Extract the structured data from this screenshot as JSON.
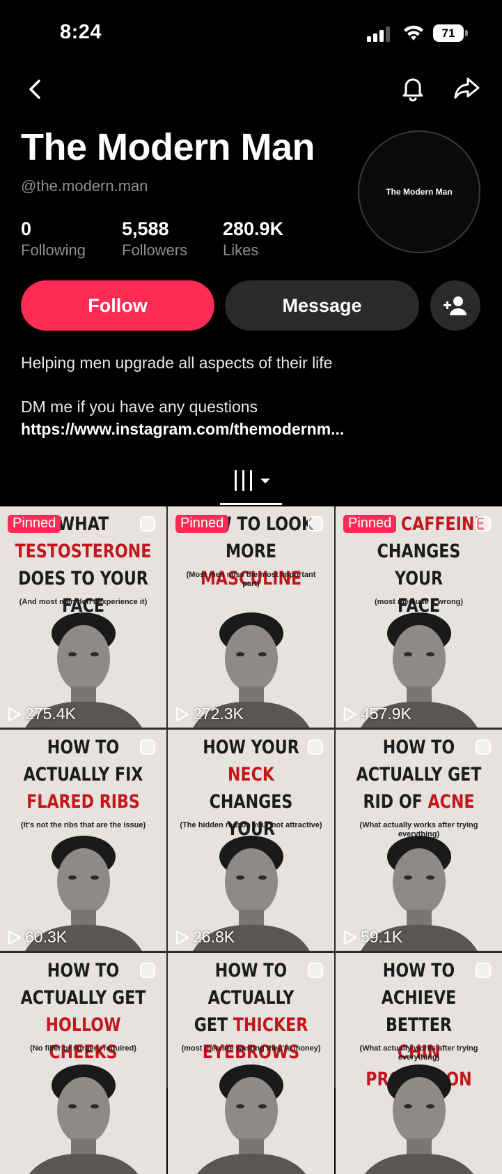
{
  "status_bar": {
    "time": "8:24",
    "battery": "71"
  },
  "profile": {
    "name": "The Modern Man",
    "handle": "@the.modern.man",
    "avatar_text": "The Modern Man",
    "stats": [
      {
        "value": "0",
        "label": "Following"
      },
      {
        "value": "5,588",
        "label": "Followers"
      },
      {
        "value": "280.9K",
        "label": "Likes"
      }
    ],
    "follow_label": "Follow",
    "message_label": "Message",
    "bio_line1": "Helping men upgrade all aspects of their life",
    "bio_line2": "DM me if you have any questions",
    "link": "https://www.instagram.com/themodernm..."
  },
  "colors": {
    "accent": "#fe2c55",
    "button_dark": "#2a2a2c",
    "secondary_text": "#8e8e93",
    "title_red": "#c4161c"
  },
  "videos": [
    {
      "pinned": "Pinned",
      "lines": [
        "WHAT",
        "TESTOSTERONE",
        "DOES TO YOUR FACE"
      ],
      "red_line": 1,
      "sub": "(And most men don't experience it)",
      "views": "275.4K"
    },
    {
      "pinned": "Pinned",
      "lines": [
        "HOW TO LOOK",
        "MORE MASCULINE"
      ],
      "red_word": "MASCULINE",
      "sub": "(Most men miss the most important part)",
      "views": "272.3K"
    },
    {
      "pinned": "Pinned",
      "lines": [
        "HOW CAFFEINE",
        "CHANGES YOUR",
        "FACE"
      ],
      "red_word": "CAFFEINE",
      "sub": "(most men use it wrong)",
      "views": "457.9K"
    },
    {
      "lines": [
        "HOW TO",
        "ACTUALLY FIX",
        "FLARED RIBS"
      ],
      "red_line": 2,
      "sub": "(It's not the ribs that are the issue)",
      "views": "60.3K"
    },
    {
      "lines": [
        "HOW YOUR NECK",
        "CHANGES YOUR",
        "FACE"
      ],
      "red_word": "NECK",
      "sub": "(The hidden reason your not attractive)",
      "views": "26.8K"
    },
    {
      "lines": [
        "HOW TO",
        "ACTUALLY GET",
        "RID OF ACNE"
      ],
      "red_word": "ACNE",
      "sub": "(What actually works after trying everything)",
      "views": "59.1K"
    },
    {
      "lines": [
        "HOW TO",
        "ACTUALLY GET",
        "HOLLOW CHEEKS"
      ],
      "red_line": 2,
      "sub": "(No filler or surgery required)",
      "views": ""
    },
    {
      "lines": [
        "HOW TO ACTUALLY",
        "GET THICKER",
        "EYEBROWS"
      ],
      "red_word": "THICKER",
      "red_line": 2,
      "sub": "(most men are wasting they're money)",
      "views": ""
    },
    {
      "lines": [
        "HOW TO ACHIEVE",
        "BETTER",
        "CHIN PROJECTION"
      ],
      "red_line": 2,
      "sub": "(What actually works after trying everything)",
      "views": ""
    }
  ]
}
